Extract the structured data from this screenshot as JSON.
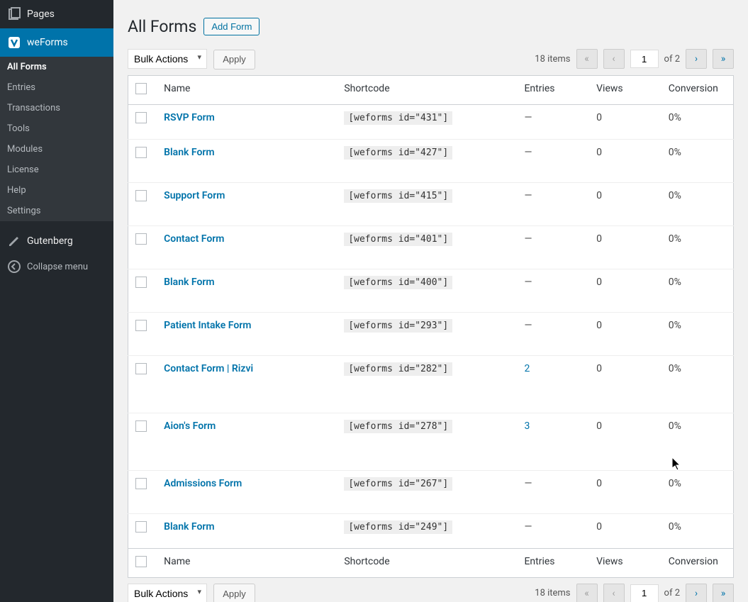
{
  "sidebar": {
    "pages": {
      "label": "Pages"
    },
    "weforms": {
      "label": "weForms"
    },
    "submenu": [
      {
        "label": "All Forms",
        "active": true
      },
      {
        "label": "Entries"
      },
      {
        "label": "Transactions"
      },
      {
        "label": "Tools"
      },
      {
        "label": "Modules"
      },
      {
        "label": "License"
      },
      {
        "label": "Help"
      },
      {
        "label": "Settings"
      }
    ],
    "gutenberg": {
      "label": "Gutenberg"
    },
    "collapse": {
      "label": "Collapse menu"
    }
  },
  "header": {
    "title": "All Forms",
    "add_button": "Add Form"
  },
  "tablenav": {
    "bulk_action_label": "Bulk Actions",
    "apply_label": "Apply",
    "items_label": "18 items",
    "current_page": "1",
    "total_pages_label": "of 2",
    "first": "«",
    "prev": "‹",
    "next": "›",
    "last": "»"
  },
  "columns": {
    "name": "Name",
    "shortcode": "Shortcode",
    "entries": "Entries",
    "views": "Views",
    "conversion": "Conversion"
  },
  "rows": [
    {
      "name": "RSVP Form",
      "shortcode": "[weforms id=\"431\"]",
      "entries": "—",
      "entries_link": false,
      "views": "0",
      "conversion": "0%",
      "short": true
    },
    {
      "name": "Blank Form",
      "shortcode": "[weforms id=\"427\"]",
      "entries": "—",
      "entries_link": false,
      "views": "0",
      "conversion": "0%"
    },
    {
      "name": "Support Form",
      "shortcode": "[weforms id=\"415\"]",
      "entries": "—",
      "entries_link": false,
      "views": "0",
      "conversion": "0%"
    },
    {
      "name": "Contact Form",
      "shortcode": "[weforms id=\"401\"]",
      "entries": "—",
      "entries_link": false,
      "views": "0",
      "conversion": "0%"
    },
    {
      "name": "Blank Form",
      "shortcode": "[weforms id=\"400\"]",
      "entries": "—",
      "entries_link": false,
      "views": "0",
      "conversion": "0%"
    },
    {
      "name": "Patient Intake Form",
      "shortcode": "[weforms id=\"293\"]",
      "entries": "—",
      "entries_link": false,
      "views": "0",
      "conversion": "0%"
    },
    {
      "name": "Contact Form | Rizvi",
      "shortcode": "[weforms id=\"282\"]",
      "entries": "2",
      "entries_link": true,
      "views": "0",
      "conversion": "0%",
      "tall": true
    },
    {
      "name": "Aion's Form",
      "shortcode": "[weforms id=\"278\"]",
      "entries": "3",
      "entries_link": true,
      "views": "0",
      "conversion": "0%",
      "tall": true
    },
    {
      "name": "Admissions Form",
      "shortcode": "[weforms id=\"267\"]",
      "entries": "—",
      "entries_link": false,
      "views": "0",
      "conversion": "0%"
    },
    {
      "name": "Blank Form",
      "shortcode": "[weforms id=\"249\"]",
      "entries": "—",
      "entries_link": false,
      "views": "0",
      "conversion": "0%",
      "short": true
    }
  ]
}
